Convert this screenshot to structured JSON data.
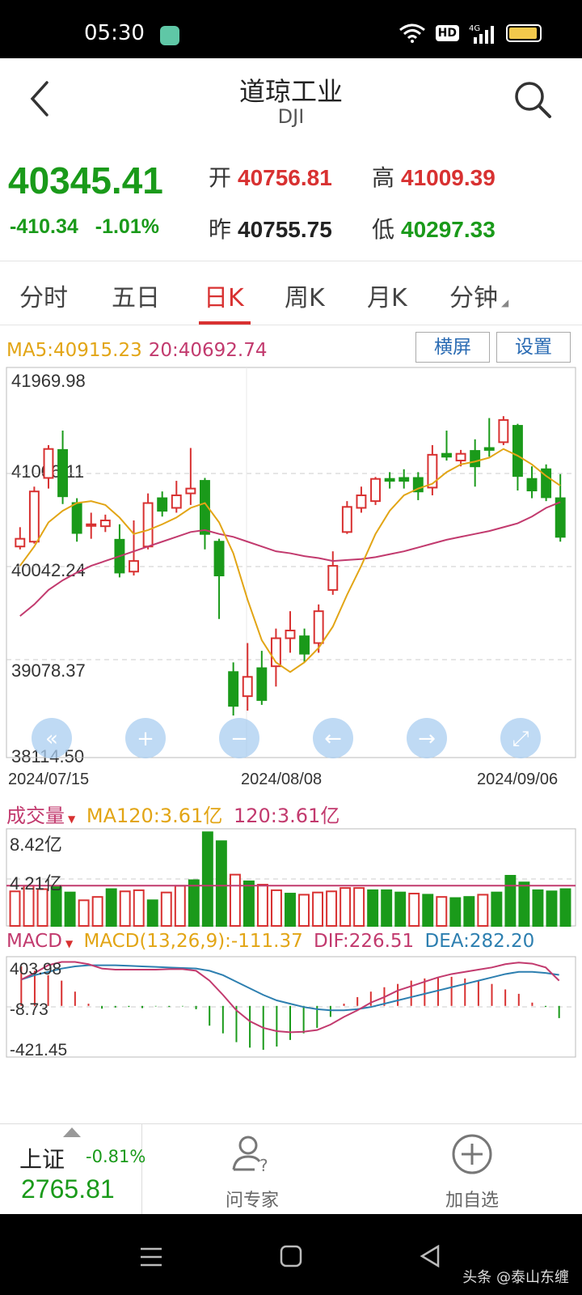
{
  "status_bar": {
    "time": "05:30",
    "hd": "HD",
    "network": "4G"
  },
  "header": {
    "title": "道琼工业",
    "code": "DJI"
  },
  "quote": {
    "price": "40345.41",
    "change": "-410.34",
    "change_pct": "-1.01%",
    "open_label": "开",
    "open": "40756.81",
    "high_label": "高",
    "high": "41009.39",
    "prev_label": "昨",
    "prev": "40755.75",
    "low_label": "低",
    "low": "40297.33"
  },
  "tabs": [
    {
      "label": "分时"
    },
    {
      "label": "五日"
    },
    {
      "label": "日K"
    },
    {
      "label": "周K"
    },
    {
      "label": "月K"
    },
    {
      "label": "分钟"
    }
  ],
  "ma_legend": {
    "ma5": "MA5:40915.23",
    "ma20": "20:40692.74"
  },
  "buttons": {
    "landscape": "横屏",
    "settings": "设置"
  },
  "kline": {
    "y_ticks": [
      "41969.98",
      "41006.11",
      "40042.24",
      "39078.37",
      "38114.50"
    ],
    "x_ticks": [
      "2024/07/15",
      "2024/08/08",
      "2024/09/06"
    ]
  },
  "volume": {
    "title": "成交量",
    "ma120": "MA120:3.61亿",
    "v120": "120:3.61亿",
    "y_top": "8.42亿",
    "y_mid": "4.21亿"
  },
  "macd": {
    "title": "MACD",
    "params": "MACD(13,26,9):-111.37",
    "dif": "DIF:226.51",
    "dea": "DEA:282.20",
    "y_top": "403.98",
    "y_mid": "-8.73",
    "y_bot": "-421.45"
  },
  "bottom": {
    "index_name": "上证",
    "index_pct": "-0.81%",
    "index_value": "2765.81",
    "ask_expert": "问专家",
    "add_watch": "加自选"
  },
  "watermark": "头条 @泰山东缠",
  "colors": {
    "up": "#d83131",
    "down": "#1a9a1a",
    "ma5": "#e2a515",
    "ma20": "#c23a6e",
    "dea": "#2d7fb0"
  },
  "chart_data": {
    "type": "candlestick",
    "ylim": [
      38114.5,
      41969.98
    ],
    "candles": [
      {
        "o": 40250,
        "c": 40330,
        "h": 40450,
        "l": 40220
      },
      {
        "o": 40300,
        "c": 40820,
        "h": 40870,
        "l": 40280
      },
      {
        "o": 40960,
        "c": 41260,
        "h": 41300,
        "l": 40850
      },
      {
        "o": 41250,
        "c": 40770,
        "h": 41450,
        "l": 40690
      },
      {
        "o": 40700,
        "c": 40390,
        "h": 40750,
        "l": 40300
      },
      {
        "o": 40470,
        "c": 40480,
        "h": 40600,
        "l": 40330
      },
      {
        "o": 40460,
        "c": 40520,
        "h": 40580,
        "l": 40400
      },
      {
        "o": 40320,
        "c": 39980,
        "h": 40480,
        "l": 39930
      },
      {
        "o": 39990,
        "c": 40100,
        "h": 40520,
        "l": 39950
      },
      {
        "o": 40250,
        "c": 40700,
        "h": 40800,
        "l": 40220
      },
      {
        "o": 40750,
        "c": 40620,
        "h": 40820,
        "l": 40560
      },
      {
        "o": 40650,
        "c": 40780,
        "h": 40930,
        "l": 40600
      },
      {
        "o": 40800,
        "c": 40850,
        "h": 41270,
        "l": 40680
      },
      {
        "o": 40930,
        "c": 40380,
        "h": 40960,
        "l": 40220
      },
      {
        "o": 40300,
        "c": 39950,
        "h": 40330,
        "l": 39500
      },
      {
        "o": 38950,
        "c": 38600,
        "h": 39050,
        "l": 38500
      },
      {
        "o": 38700,
        "c": 38900,
        "h": 39250,
        "l": 38550
      },
      {
        "o": 38990,
        "c": 38660,
        "h": 39170,
        "l": 38610
      },
      {
        "o": 39010,
        "c": 39300,
        "h": 39400,
        "l": 38800
      },
      {
        "o": 39300,
        "c": 39380,
        "h": 39580,
        "l": 39150
      },
      {
        "o": 39320,
        "c": 39140,
        "h": 39400,
        "l": 39050
      },
      {
        "o": 39250,
        "c": 39580,
        "h": 39650,
        "l": 39150
      },
      {
        "o": 39800,
        "c": 40050,
        "h": 40200,
        "l": 39750
      },
      {
        "o": 40400,
        "c": 40660,
        "h": 40720,
        "l": 40380
      },
      {
        "o": 40650,
        "c": 40780,
        "h": 40870,
        "l": 40600
      },
      {
        "o": 40720,
        "c": 40950,
        "h": 40970,
        "l": 40680
      },
      {
        "o": 40950,
        "c": 40930,
        "h": 41020,
        "l": 40850
      },
      {
        "o": 40960,
        "c": 40930,
        "h": 41050,
        "l": 40850
      },
      {
        "o": 40960,
        "c": 40820,
        "h": 41020,
        "l": 40730
      },
      {
        "o": 40860,
        "c": 41200,
        "h": 41300,
        "l": 40780
      },
      {
        "o": 41210,
        "c": 41180,
        "h": 41450,
        "l": 41140
      },
      {
        "o": 41140,
        "c": 41210,
        "h": 41250,
        "l": 41080
      },
      {
        "o": 41240,
        "c": 41080,
        "h": 41360,
        "l": 40870
      },
      {
        "o": 41270,
        "c": 41250,
        "h": 41580,
        "l": 41180
      },
      {
        "o": 41330,
        "c": 41560,
        "h": 41600,
        "l": 41300
      },
      {
        "o": 41500,
        "c": 40980,
        "h": 41520,
        "l": 40830
      },
      {
        "o": 40950,
        "c": 40830,
        "h": 41080,
        "l": 40750
      },
      {
        "o": 41050,
        "c": 40760,
        "h": 41100,
        "l": 40720
      },
      {
        "o": 40750,
        "c": 40350,
        "h": 41000,
        "l": 40300
      }
    ],
    "ma5": [
      40050,
      40250,
      40500,
      40620,
      40700,
      40720,
      40680,
      40550,
      40380,
      40420,
      40480,
      40550,
      40650,
      40700,
      40500,
      40180,
      39700,
      39280,
      39050,
      38950,
      39050,
      39200,
      39420,
      39750,
      40050,
      40380,
      40620,
      40780,
      40850,
      40900,
      41020,
      41100,
      41130,
      41170,
      41260,
      41190,
      41100,
      40980,
      40880
    ],
    "ma20": [
      39530,
      39650,
      39800,
      39900,
      39980,
      40050,
      40100,
      40150,
      40200,
      40250,
      40300,
      40350,
      40400,
      40420,
      40380,
      40350,
      40300,
      40250,
      40200,
      40180,
      40150,
      40130,
      40100,
      40110,
      40120,
      40140,
      40170,
      40200,
      40240,
      40280,
      40320,
      40350,
      40380,
      40410,
      40450,
      40490,
      40560,
      40650,
      40710
    ],
    "volume_ylim": [
      0,
      8.42
    ],
    "volume": [
      3.1,
      3.6,
      3.3,
      3.6,
      3.0,
      2.3,
      2.6,
      3.3,
      3.1,
      3.2,
      2.3,
      3.0,
      3.6,
      4.1,
      8.4,
      7.6,
      4.6,
      4.0,
      3.7,
      3.2,
      2.9,
      2.8,
      3.0,
      3.1,
      3.4,
      3.4,
      3.2,
      3.2,
      3.0,
      2.9,
      2.8,
      2.6,
      2.5,
      2.6,
      2.8,
      3.0,
      4.5,
      3.9,
      3.2,
      3.1,
      3.3
    ],
    "volume_ma120": 3.61,
    "macd_ylim": [
      -421.45,
      403.98
    ],
    "macd_hist": [
      360,
      320,
      280,
      230,
      130,
      20,
      -25,
      -15,
      -10,
      -20,
      -5,
      -10,
      -5,
      -30,
      -180,
      -250,
      -330,
      -380,
      -400,
      -370,
      -310,
      -250,
      -200,
      -100,
      20,
      80,
      130,
      170,
      200,
      230,
      250,
      260,
      265,
      250,
      230,
      200,
      150,
      110,
      30,
      -10,
      -111
    ],
    "dif": [
      240,
      300,
      370,
      400,
      400,
      380,
      340,
      330,
      330,
      330,
      330,
      335,
      335,
      320,
      230,
      100,
      -40,
      -140,
      -200,
      -230,
      -240,
      -235,
      -220,
      -170,
      -100,
      -40,
      30,
      80,
      140,
      180,
      220,
      260,
      290,
      310,
      330,
      350,
      380,
      395,
      385,
      350,
      230
    ],
    "dea": [
      240,
      280,
      310,
      340,
      360,
      370,
      370,
      370,
      365,
      360,
      355,
      350,
      345,
      340,
      320,
      280,
      220,
      160,
      100,
      50,
      20,
      -10,
      -30,
      -40,
      -40,
      -30,
      -10,
      20,
      50,
      80,
      110,
      140,
      170,
      200,
      230,
      260,
      290,
      310,
      310,
      300,
      282
    ]
  }
}
